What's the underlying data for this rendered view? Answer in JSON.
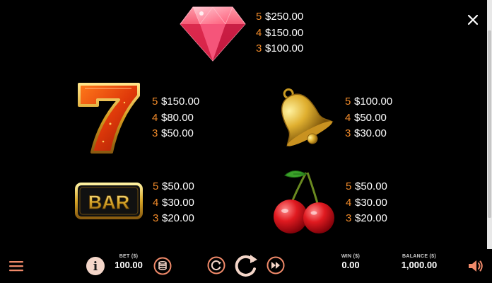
{
  "paytable": {
    "diamond": {
      "payouts": [
        {
          "count": "5",
          "amount": "$250.00"
        },
        {
          "count": "4",
          "amount": "$150.00"
        },
        {
          "count": "3",
          "amount": "$100.00"
        }
      ]
    },
    "seven": {
      "payouts": [
        {
          "count": "5",
          "amount": "$150.00"
        },
        {
          "count": "4",
          "amount": "$80.00"
        },
        {
          "count": "3",
          "amount": "$50.00"
        }
      ]
    },
    "bell": {
      "payouts": [
        {
          "count": "5",
          "amount": "$100.00"
        },
        {
          "count": "4",
          "amount": "$50.00"
        },
        {
          "count": "3",
          "amount": "$30.00"
        }
      ]
    },
    "bar": {
      "label": "BAR",
      "payouts": [
        {
          "count": "5",
          "amount": "$50.00"
        },
        {
          "count": "4",
          "amount": "$30.00"
        },
        {
          "count": "3",
          "amount": "$20.00"
        }
      ]
    },
    "cherry": {
      "payouts": [
        {
          "count": "5",
          "amount": "$50.00"
        },
        {
          "count": "4",
          "amount": "$30.00"
        },
        {
          "count": "3",
          "amount": "$20.00"
        }
      ]
    }
  },
  "bottom_bar": {
    "bet_label": "BET ($)",
    "bet_value": "100.00",
    "win_label": "WIN ($)",
    "win_value": "0.00",
    "balance_label": "BALANCE ($)",
    "balance_value": "1,000.00",
    "info_glyph": "i"
  },
  "colors": {
    "accent": "#f08a2a",
    "icon_ring": "#f4d6c9",
    "background": "#000000"
  },
  "icons": [
    "close-icon",
    "menu-icon",
    "info-icon",
    "coin-stack-icon",
    "replay-icon",
    "spin-icon",
    "fast-forward-icon",
    "sound-icon"
  ]
}
